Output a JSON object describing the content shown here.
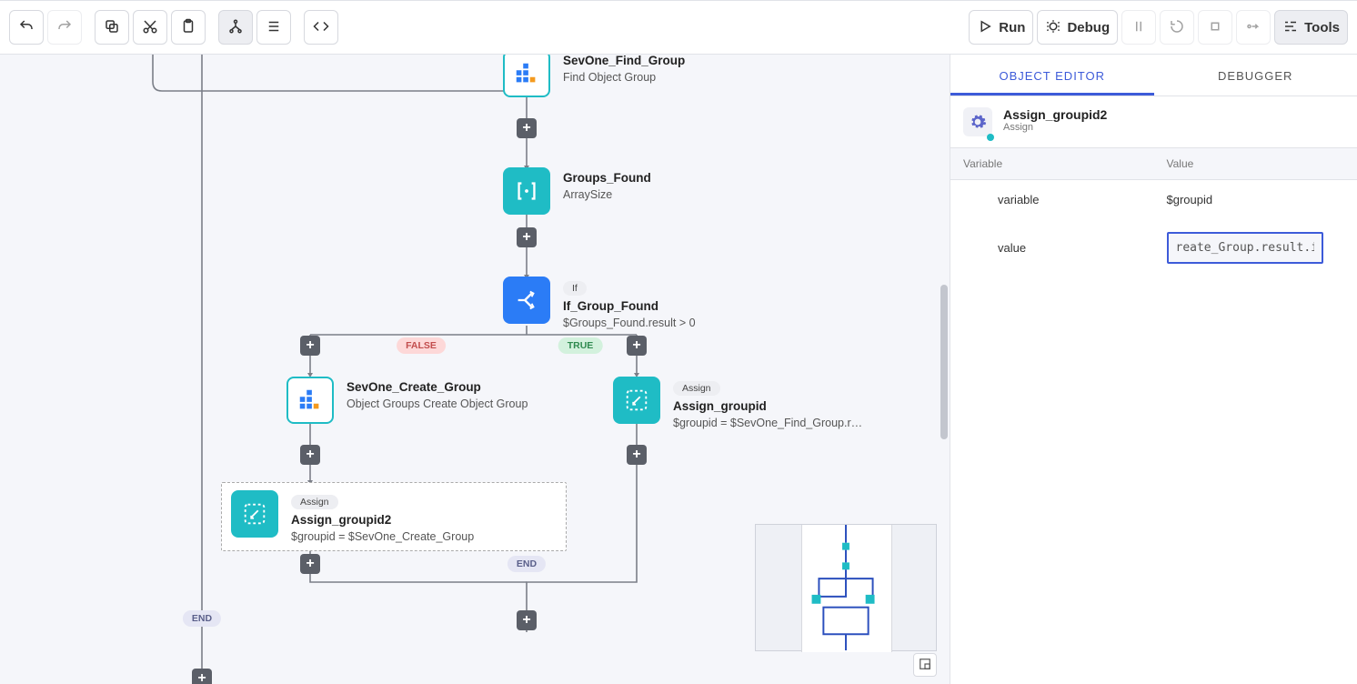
{
  "toolbar": {
    "run_label": "Run",
    "debug_label": "Debug",
    "tools_label": "Tools"
  },
  "canvas": {
    "nodes": {
      "sevone_find_group": {
        "title": "SevOne_Find_Group",
        "subtitle": "Find Object Group"
      },
      "groups_found": {
        "title": "Groups_Found",
        "subtitle": "ArraySize"
      },
      "if_group_found": {
        "badge": "If",
        "title": "If_Group_Found",
        "subtitle": "$Groups_Found.result > 0"
      },
      "sevone_create_group": {
        "title": "SevOne_Create_Group",
        "subtitle": "Object Groups Create Object Group"
      },
      "assign_groupid": {
        "badge": "Assign",
        "title": "Assign_groupid",
        "subtitle": "$groupid = $SevOne_Find_Group.result.c…"
      },
      "assign_groupid2": {
        "badge": "Assign",
        "title": "Assign_groupid2",
        "subtitle": "$groupid = $SevOne_Create_Group"
      }
    },
    "branch_labels": {
      "false": "FALSE",
      "true": "TRUE",
      "end1": "END",
      "end2": "END"
    }
  },
  "right_panel": {
    "tabs": {
      "object_editor": "OBJECT EDITOR",
      "debugger": "DEBUGGER"
    },
    "object": {
      "title": "Assign_groupid2",
      "subtitle": "Assign"
    },
    "prop_headers": {
      "variable": "Variable",
      "value": "Value"
    },
    "rows": {
      "variable": {
        "label": "variable",
        "value": "$groupid"
      },
      "value": {
        "label": "value",
        "value": "reate_Group.result.id"
      }
    }
  }
}
